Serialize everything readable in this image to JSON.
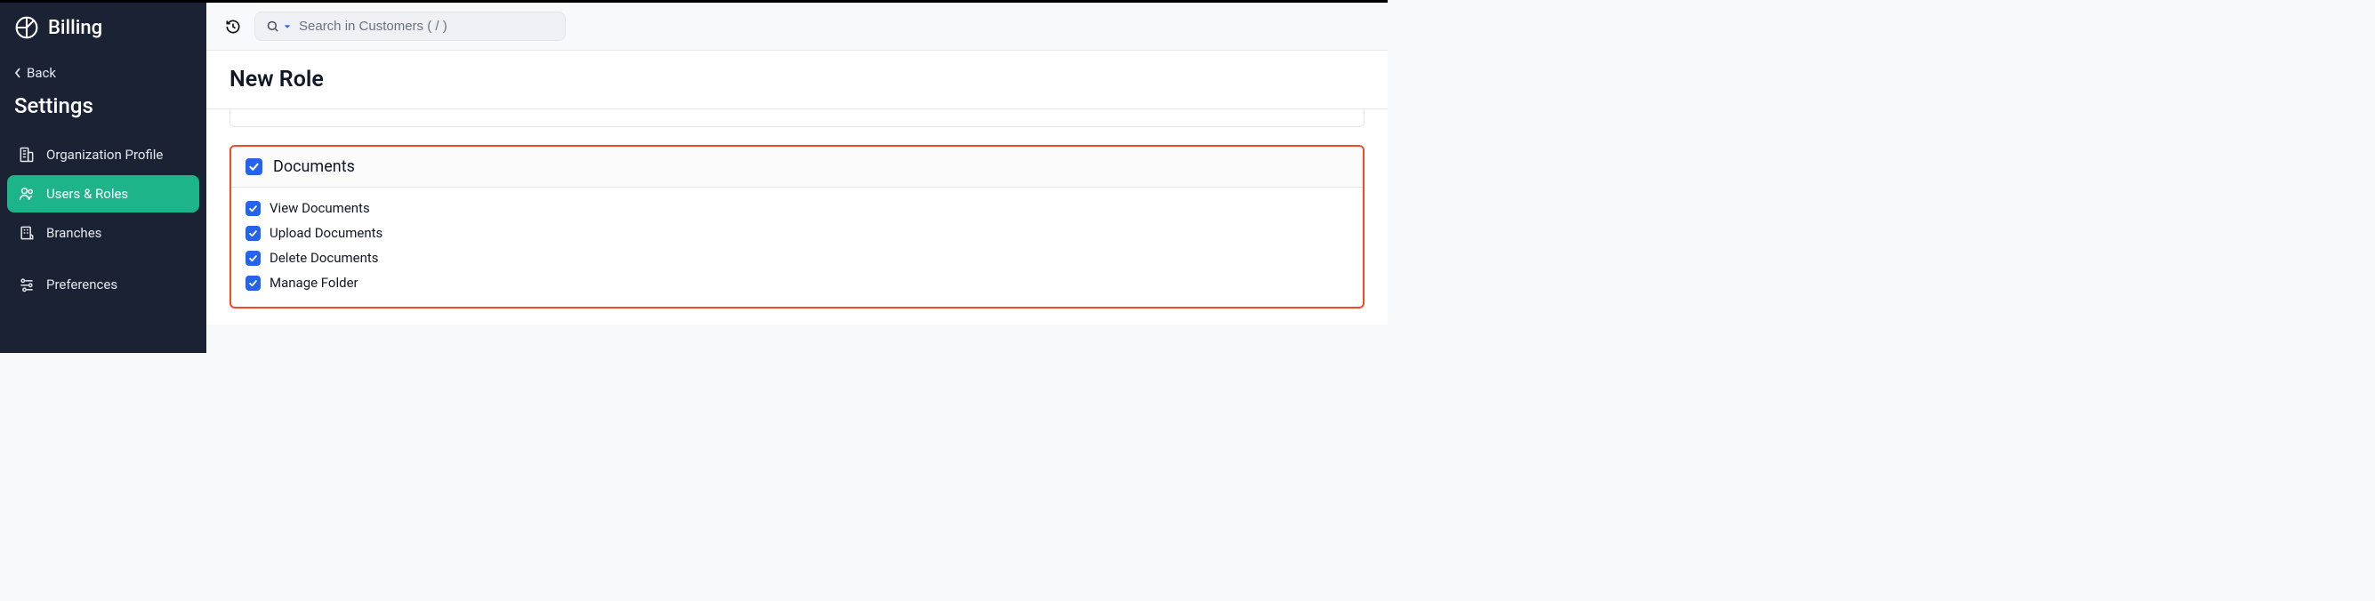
{
  "brand": "Billing",
  "back_label": "Back",
  "sidebar_title": "Settings",
  "nav": {
    "org_profile": "Organization Profile",
    "users_roles": "Users & Roles",
    "branches": "Branches",
    "preferences": "Preferences"
  },
  "search": {
    "placeholder": "Search in Customers ( / )"
  },
  "page_title": "New Role",
  "permission_group": {
    "title": "Documents",
    "items": {
      "view": "View Documents",
      "upload": "Upload Documents",
      "delete": "Delete Documents",
      "manage": "Manage Folder"
    }
  }
}
